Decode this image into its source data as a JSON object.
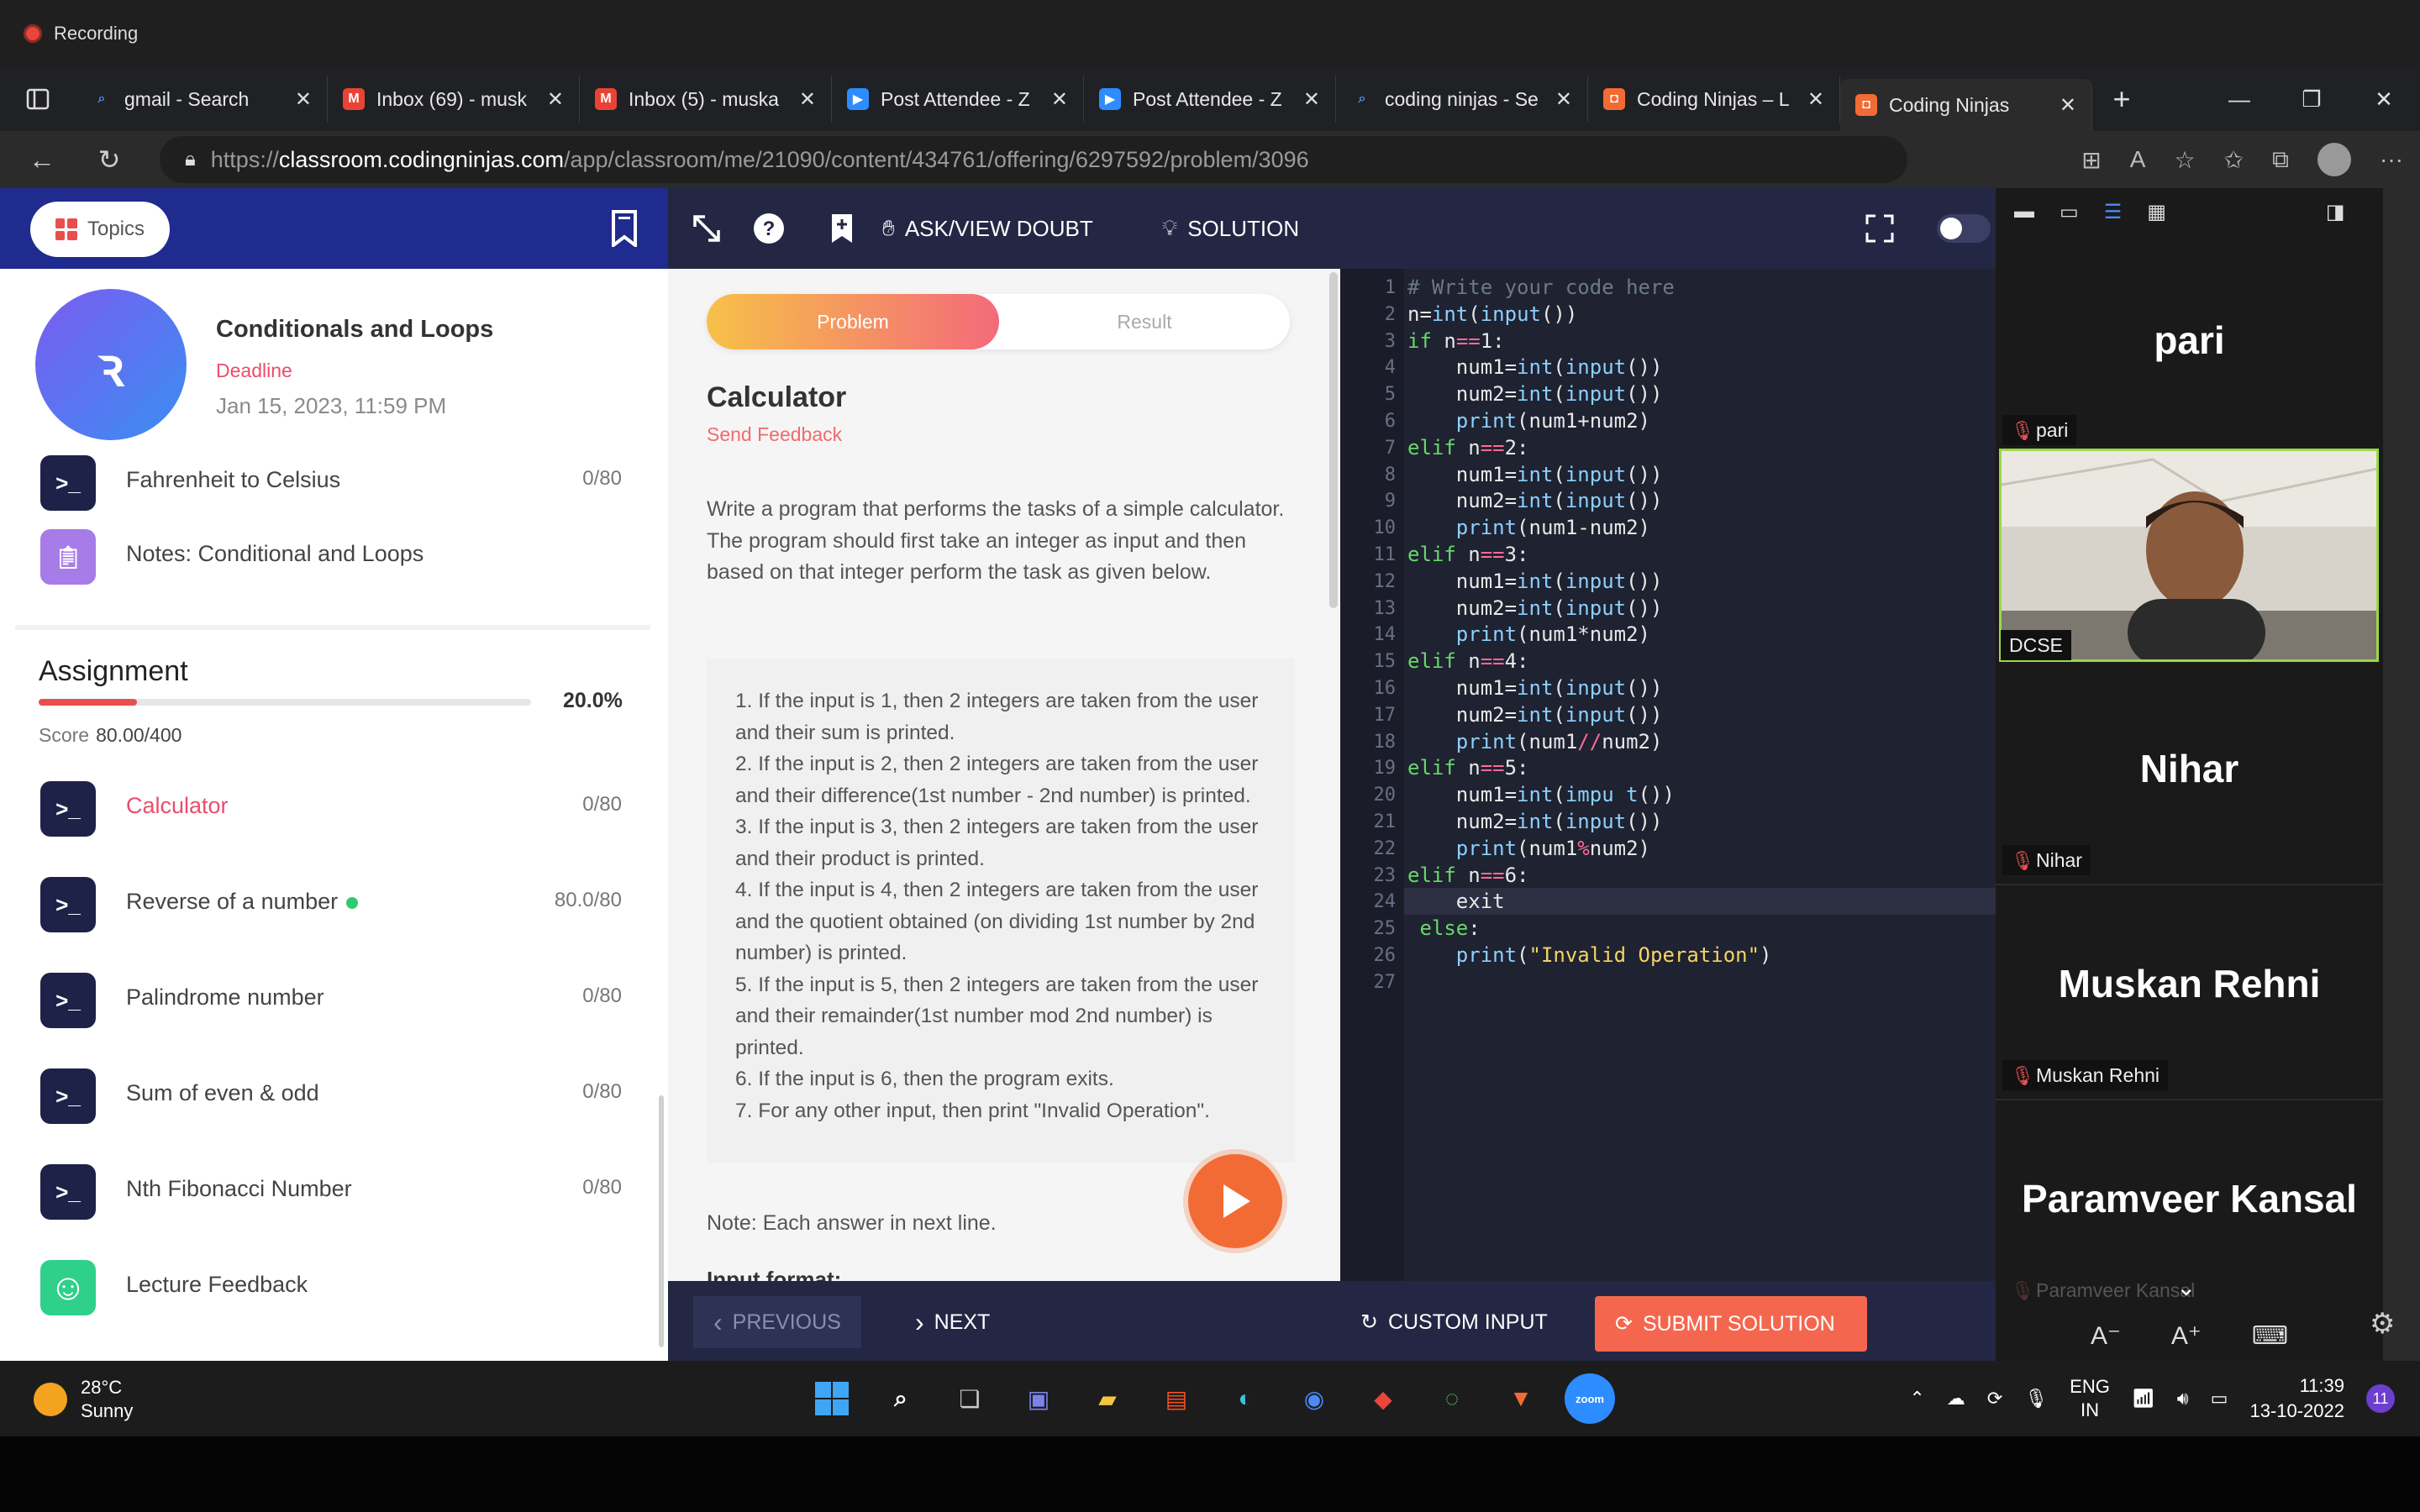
{
  "recording": {
    "label": "Recording"
  },
  "tabs": [
    {
      "label": "gmail - Search",
      "icon": "search-icon",
      "color": "#4a8af4"
    },
    {
      "label": "Inbox (69) - musk",
      "icon": "gmail-icon",
      "color": "#ea4335"
    },
    {
      "label": "Inbox (5) - muska",
      "icon": "gmail-icon",
      "color": "#ea4335"
    },
    {
      "label": "Post Attendee - Z",
      "icon": "zoom-icon",
      "color": "#2d8cff"
    },
    {
      "label": "Post Attendee - Z",
      "icon": "zoom-icon",
      "color": "#2d8cff"
    },
    {
      "label": "coding ninjas - Se",
      "icon": "search-icon",
      "color": "#4a8af4"
    },
    {
      "label": "Coding Ninjas – L",
      "icon": "codingninjas-icon",
      "color": "#f26b35"
    },
    {
      "label": "Coding Ninjas",
      "icon": "codingninjas-icon",
      "color": "#f26b35",
      "active": true
    }
  ],
  "address": {
    "scheme": "https://",
    "host": "classroom.codingninjas.com",
    "path": "/app/classroom/me/21090/content/434761/offering/6297592/problem/3096"
  },
  "sidebar": {
    "topics_label": "Topics",
    "course_title": "Conditionals and Loops",
    "deadline_label": "Deadline",
    "deadline_date": "Jan 15, 2023, 11:59 PM",
    "above_items": [
      {
        "label": "Fahrenheit to Celsius",
        "score": "0/80",
        "icon": "terminal-icon"
      },
      {
        "label": "Notes: Conditional and Loops",
        "score": "",
        "icon": "notes-icon"
      }
    ],
    "assignment_title": "Assignment",
    "assignment_percent": "20.0%",
    "assignment_progress": 0.2,
    "score_label": "Score",
    "score_value": "80.00/400",
    "items": [
      {
        "label": "Calculator",
        "score": "0/80",
        "active": true
      },
      {
        "label": "Reverse of a number",
        "score": "80.0/80",
        "done": true
      },
      {
        "label": "Palindrome number",
        "score": "0/80"
      },
      {
        "label": "Sum of even & odd",
        "score": "0/80"
      },
      {
        "label": "Nth Fibonacci Number",
        "score": "0/80"
      },
      {
        "label": "Lecture Feedback",
        "score": "",
        "icon": "smiley-icon"
      }
    ]
  },
  "toolbar": {
    "ask_doubt": "ASK/VIEW DOUBT",
    "solution": "SOLUTION"
  },
  "problem": {
    "tab_problem": "Problem",
    "tab_result": "Result",
    "title": "Calculator",
    "feedback": "Send Feedback",
    "description": "Write a program that performs the tasks of a simple calculator. The program should first take an integer as input and then based on that integer perform the task as given below.",
    "rules": [
      "1. If the input is 1, then 2 integers are taken from the user and their sum is printed.",
      "2. If the input is 2, then 2 integers are taken from the user and their difference(1st number - 2nd number) is printed.",
      "3. If the input is 3, then 2 integers are taken from the user and their product is printed.",
      "4. If the input is 4, then 2 integers are taken from the user and the quotient obtained (on dividing 1st number by 2nd number) is printed.",
      "5. If the input is 5, then 2 integers are taken from the user and their remainder(1st number mod 2nd number) is printed.",
      "6. If the input is 6, then the program exits.",
      "7. For any other input, then print \"Invalid Operation\"."
    ],
    "note": "Note: Each answer in next line.",
    "input_format": "Input format:"
  },
  "editor": {
    "lines": [
      "# Write your code here",
      "n=int(input())",
      "if n==1:",
      "    num1=int(input())",
      "    num2=int(input())",
      "    print(num1+num2)",
      "elif n==2:",
      "    num1=int(input())",
      "    num2=int(input())",
      "    print(num1-num2)",
      "elif n==3:",
      "    num1=int(input())",
      "    num2=int(input())",
      "    print(num1*num2)",
      "elif n==4:",
      "    num1=int(input())",
      "    num2=int(input())",
      "    print(num1//num2)",
      "elif n==5:",
      "    num1=int(impu t())",
      "    num2=int(input())",
      "    print(num1%num2)",
      "elif n==6:",
      "    exit",
      " else:",
      "    print(\"Invalid Operation\")",
      ""
    ],
    "active_line": 24
  },
  "bottom": {
    "previous": "PREVIOUS",
    "next": "NEXT",
    "custom_input": "CUSTOM INPUT",
    "submit": "SUBMIT SOLUTION"
  },
  "zoom": {
    "participants": [
      {
        "big": "pari",
        "tag": "pari"
      },
      {
        "tag": "DCSE"
      },
      {
        "big": "Nihar",
        "tag": "Nihar"
      },
      {
        "big": "Muskan Rehni",
        "tag": "Muskan Rehni"
      },
      {
        "big": "Paramveer Kansal",
        "tag": "Paramveer Kansal"
      }
    ]
  },
  "taskbar": {
    "temperature": "28°C",
    "weather": "Sunny",
    "lang1": "ENG",
    "lang2": "IN",
    "time": "11:39",
    "date": "13-10-2022",
    "notifications": "11"
  }
}
